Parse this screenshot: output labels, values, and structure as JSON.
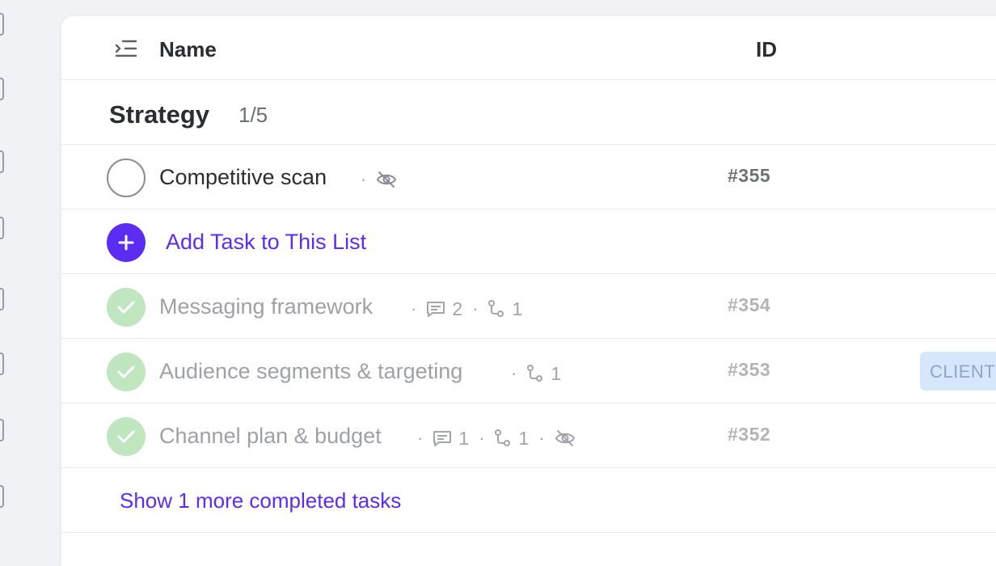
{
  "header": {
    "name_label": "Name",
    "id_label": "ID"
  },
  "group": {
    "title": "Strategy",
    "count": "1/5"
  },
  "add_task": {
    "label": "Add Task to This List"
  },
  "tasks": [
    {
      "name": "Competitive scan",
      "id": "#355",
      "status": "open",
      "comments": "",
      "subtasks": "",
      "hidden": true
    },
    {
      "name": "Messaging framework",
      "id": "#354",
      "status": "done",
      "comments": "2",
      "subtasks": "1",
      "hidden": false
    },
    {
      "name": "Audience segments & targeting",
      "id": "#353",
      "status": "done",
      "comments": "",
      "subtasks": "1",
      "hidden": false,
      "tag": "CLIENT"
    },
    {
      "name": "Channel plan & budget",
      "id": "#352",
      "status": "done",
      "comments": "1",
      "subtasks": "1",
      "hidden": true
    }
  ],
  "show_more": {
    "label": "Show 1 more completed tasks"
  },
  "colors": {
    "accent": "#5b2cf2",
    "done_fill": "#bfe6bf",
    "tag_bg": "#d6e6fb"
  }
}
